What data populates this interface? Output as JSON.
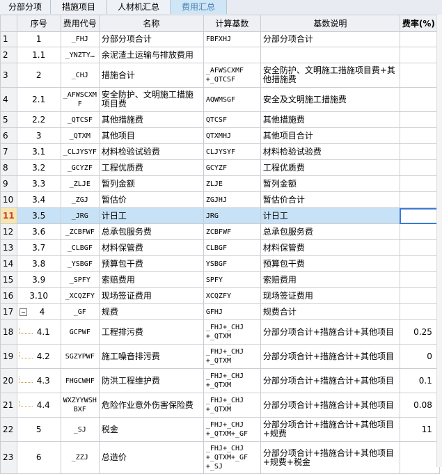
{
  "tabs": [
    {
      "label": "分部分项",
      "active": false
    },
    {
      "label": "措施项目",
      "active": false
    },
    {
      "label": "人材机汇总",
      "active": false
    },
    {
      "label": "费用汇总",
      "active": true
    }
  ],
  "columns": {
    "seq": "序号",
    "code": "费用代号",
    "name": "名称",
    "base": "计算基数",
    "desc": "基数说明",
    "rate": "费率(%)"
  },
  "rows": [
    {
      "num": "1",
      "seq": "1",
      "code": "_FHJ",
      "name": "分部分项合计",
      "base": "FBFXHJ",
      "desc": "分部分项合计",
      "rate": ""
    },
    {
      "num": "2",
      "seq": "1.1",
      "code": "_YNZTY…",
      "name": "余泥渣土运输与排放费用",
      "base": "",
      "desc": "",
      "rate": ""
    },
    {
      "num": "3",
      "seq": "2",
      "code": "_CHJ",
      "name": "措施合计",
      "base": "_AFWSCXMF\n+_QTCSF",
      "desc": "安全防护、文明施工措施项目费+其他措施费",
      "rate": ""
    },
    {
      "num": "4",
      "seq": "2.1",
      "code": "_AFWSCXM\nF",
      "name": "安全防护、文明施工措施项目费",
      "base": "AQWMSGF",
      "desc": "安全及文明施工措施费",
      "rate": ""
    },
    {
      "num": "5",
      "seq": "2.2",
      "code": "_QTCSF",
      "name": "其他措施费",
      "base": "QTCSF",
      "desc": "其他措施费",
      "rate": ""
    },
    {
      "num": "6",
      "seq": "3",
      "code": "_QTXM",
      "name": "其他项目",
      "base": "QTXMHJ",
      "desc": "其他项目合计",
      "rate": ""
    },
    {
      "num": "7",
      "seq": "3.1",
      "code": "_CLJYSYF",
      "name": "材料检验试验费",
      "base": "CLJYSYF",
      "desc": "材料检验试验费",
      "rate": ""
    },
    {
      "num": "8",
      "seq": "3.2",
      "code": "_GCYZF",
      "name": "工程优质费",
      "base": "GCYZF",
      "desc": "工程优质费",
      "rate": ""
    },
    {
      "num": "9",
      "seq": "3.3",
      "code": "_ZLJE",
      "name": "暂列金额",
      "base": "ZLJE",
      "desc": "暂列金额",
      "rate": ""
    },
    {
      "num": "10",
      "seq": "3.4",
      "code": "_ZGJ",
      "name": "暂估价",
      "base": "ZGJHJ",
      "desc": "暂估价合计",
      "rate": ""
    },
    {
      "num": "11",
      "seq": "3.5",
      "code": "_JRG",
      "name": "计日工",
      "base": "JRG",
      "desc": "计日工",
      "rate": ""
    },
    {
      "num": "12",
      "seq": "3.6",
      "code": "_ZCBFWF",
      "name": "总承包服务费",
      "base": "ZCBFWF",
      "desc": "总承包服务费",
      "rate": ""
    },
    {
      "num": "13",
      "seq": "3.7",
      "code": "_CLBGF",
      "name": "材料保管费",
      "base": "CLBGF",
      "desc": "材料保管费",
      "rate": ""
    },
    {
      "num": "14",
      "seq": "3.8",
      "code": "_YSBGF",
      "name": "预算包干费",
      "base": "YSBGF",
      "desc": "预算包干费",
      "rate": ""
    },
    {
      "num": "15",
      "seq": "3.9",
      "code": "_SPFY",
      "name": "索赔费用",
      "base": "SPFY",
      "desc": "索赔费用",
      "rate": ""
    },
    {
      "num": "16",
      "seq": "3.10",
      "code": "_XCQZFY",
      "name": "现场签证费用",
      "base": "XCQZFY",
      "desc": "现场签证费用",
      "rate": ""
    },
    {
      "num": "17",
      "seq": "4",
      "code": "_GF",
      "name": "规费",
      "base": "GFHJ",
      "desc": "规费合计",
      "rate": ""
    },
    {
      "num": "18",
      "seq": "4.1",
      "code": "GCPWF",
      "name": "工程排污费",
      "base": "_FHJ+_CHJ\n+_QTXM",
      "desc": "分部分项合计+措施合计+其他项目",
      "rate": "0.25"
    },
    {
      "num": "19",
      "seq": "4.2",
      "code": "SGZYPWF",
      "name": "施工噪音排污费",
      "base": "_FHJ+_CHJ\n+_QTXM",
      "desc": "分部分项合计+措施合计+其他项目",
      "rate": "0"
    },
    {
      "num": "20",
      "seq": "4.3",
      "code": "FHGCWHF",
      "name": "防洪工程维护费",
      "base": "_FHJ+_CHJ\n+_QTXM",
      "desc": "分部分项合计+措施合计+其他项目",
      "rate": "0.1"
    },
    {
      "num": "21",
      "seq": "4.4",
      "code": "WXZYYWSH\nBXF",
      "name": "危险作业意外伤害保险费",
      "base": "_FHJ+_CHJ\n+_QTXM",
      "desc": "分部分项合计+措施合计+其他项目",
      "rate": "0.08"
    },
    {
      "num": "22",
      "seq": "5",
      "code": "_SJ",
      "name": "税金",
      "base": "_FHJ+_CHJ\n+_QTXM+_GF",
      "desc": "分部分项合计+措施合计+其他项目+规费",
      "rate": "11"
    },
    {
      "num": "23",
      "seq": "6",
      "code": "_ZZJ",
      "name": "总造价",
      "base": "_FHJ+_CHJ\n+_QTXM+_GF\n+_SJ",
      "desc": "分部分项合计+措施合计+其他项目+规费+税金",
      "rate": ""
    }
  ]
}
